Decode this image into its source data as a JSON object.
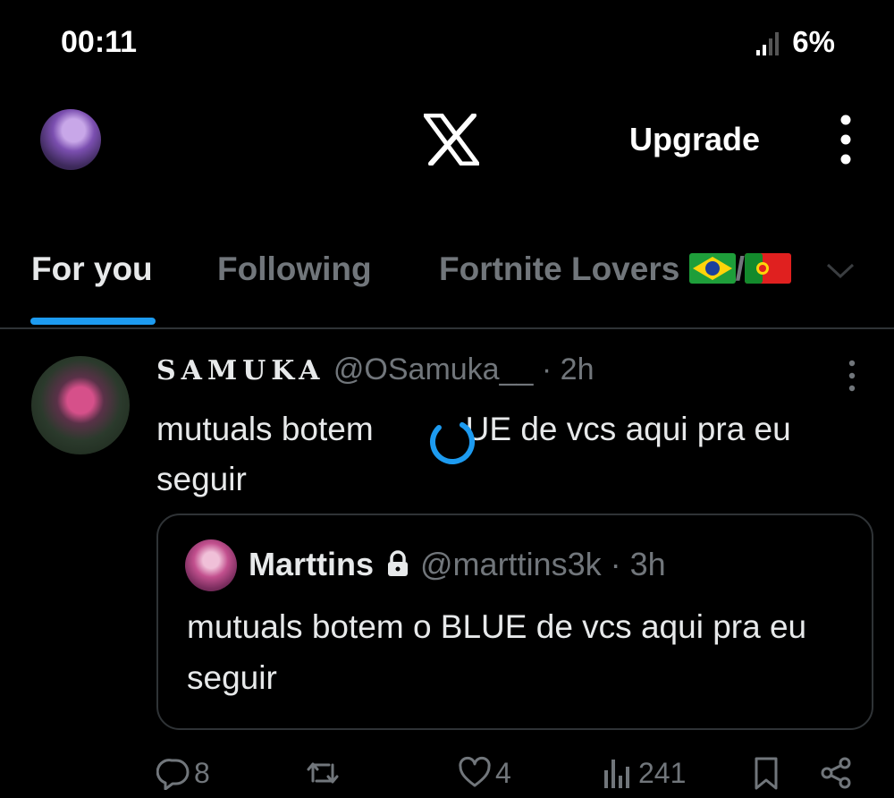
{
  "status_bar": {
    "time": "00:11",
    "battery": "6%"
  },
  "header": {
    "upgrade_label": "Upgrade"
  },
  "tabs": [
    {
      "label": "For you"
    },
    {
      "label": "Following"
    },
    {
      "label": "Fortnite Lovers",
      "flags": [
        "brazil-flag",
        "portugal-flag"
      ],
      "separator": "/"
    }
  ],
  "tweet": {
    "name": "SAMUKA",
    "handle": "@OSamuka__",
    "dot": "·",
    "time": "2h",
    "text_part1": "mutuals botem",
    "text_part2": "UE de vcs aqui pra eu seguir",
    "quote": {
      "name": "Marttins",
      "handle": "@marttins3k",
      "dot": "·",
      "time": "3h",
      "text": "mutuals botem o BLUE de vcs aqui pra eu seguir"
    },
    "actions": {
      "replies": "8",
      "reposts": "",
      "likes": "4",
      "views": "241"
    }
  },
  "colors": {
    "accent": "#1d9bf0",
    "background": "#000000",
    "muted": "#71767b",
    "text": "#e7e9ea"
  }
}
